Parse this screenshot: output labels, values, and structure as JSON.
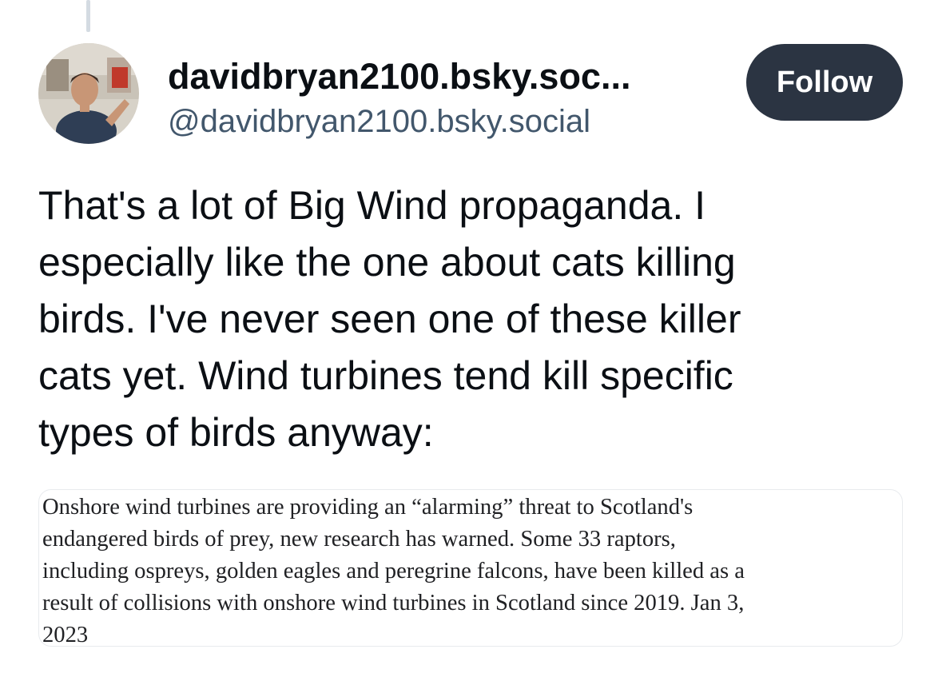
{
  "post": {
    "author": {
      "display_name": "davidbryan2100.bsky.soc...",
      "handle": "@davidbryan2100.bsky.social",
      "avatar_icon": "profile-photo"
    },
    "follow_label": "Follow",
    "text": "That's a lot of Big Wind propaganda. I\nespecially like the one about cats killing\nbirds. I've never seen one of these killer\ncats yet. Wind turbines tend kill specific\ntypes of birds anyway:",
    "embed": {
      "text": "Onshore wind turbines are providing an “alarming” threat to Scotland's\nendangered birds of prey, new research has warned. Some 33 raptors,\nincluding ospreys, golden eagles and peregrine falcons, have been killed as a\nresult of collisions with onshore wind turbines in Scotland since 2019. Jan 3,\n2023"
    }
  },
  "colors": {
    "follow_button_bg": "#2b3442",
    "handle_text": "#42576c",
    "thread_line": "#d4dbe2"
  }
}
